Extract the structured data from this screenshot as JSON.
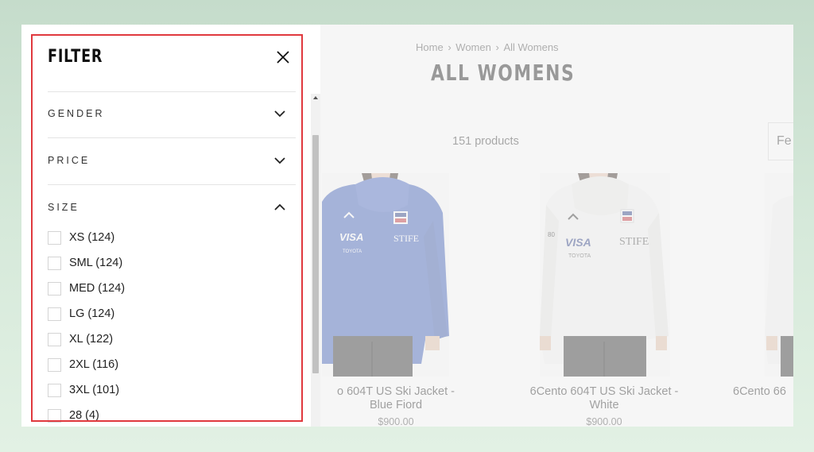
{
  "filter": {
    "title": "FILTER",
    "sections": {
      "gender": {
        "label": "GENDER",
        "expanded": false
      },
      "price": {
        "label": "PRICE",
        "expanded": false
      },
      "size": {
        "label": "SIZE",
        "expanded": true,
        "options": [
          {
            "label": "XS (124)"
          },
          {
            "label": "SML (124)"
          },
          {
            "label": "MED (124)"
          },
          {
            "label": "LG (124)"
          },
          {
            "label": "XL (122)"
          },
          {
            "label": "2XL (116)"
          },
          {
            "label": "3XL (101)"
          },
          {
            "label": "28 (4)"
          }
        ]
      }
    }
  },
  "page": {
    "breadcrumb": [
      "Home",
      "Women",
      "All Womens"
    ],
    "breadcrumb_separator": "›",
    "title": "ALL WOMENS",
    "product_count": "151 products",
    "sort_label": "Fe",
    "products": [
      {
        "name_line1": "o 604T US Ski Jacket -",
        "name_line2": "Blue Fiord",
        "price": "$900.00",
        "color": "#3f5fb9"
      },
      {
        "name_line1": "6Cento 604T US Ski Jacket -",
        "name_line2": "White",
        "price": "$900.00",
        "color": "#f4f4f2"
      },
      {
        "name_line1": "6Cento 66",
        "name_line2": "",
        "price": "",
        "color": "#f4f4f2"
      }
    ]
  },
  "colors": {
    "highlight": "#e0393e",
    "jacket_blue": "#3f5fb9"
  }
}
